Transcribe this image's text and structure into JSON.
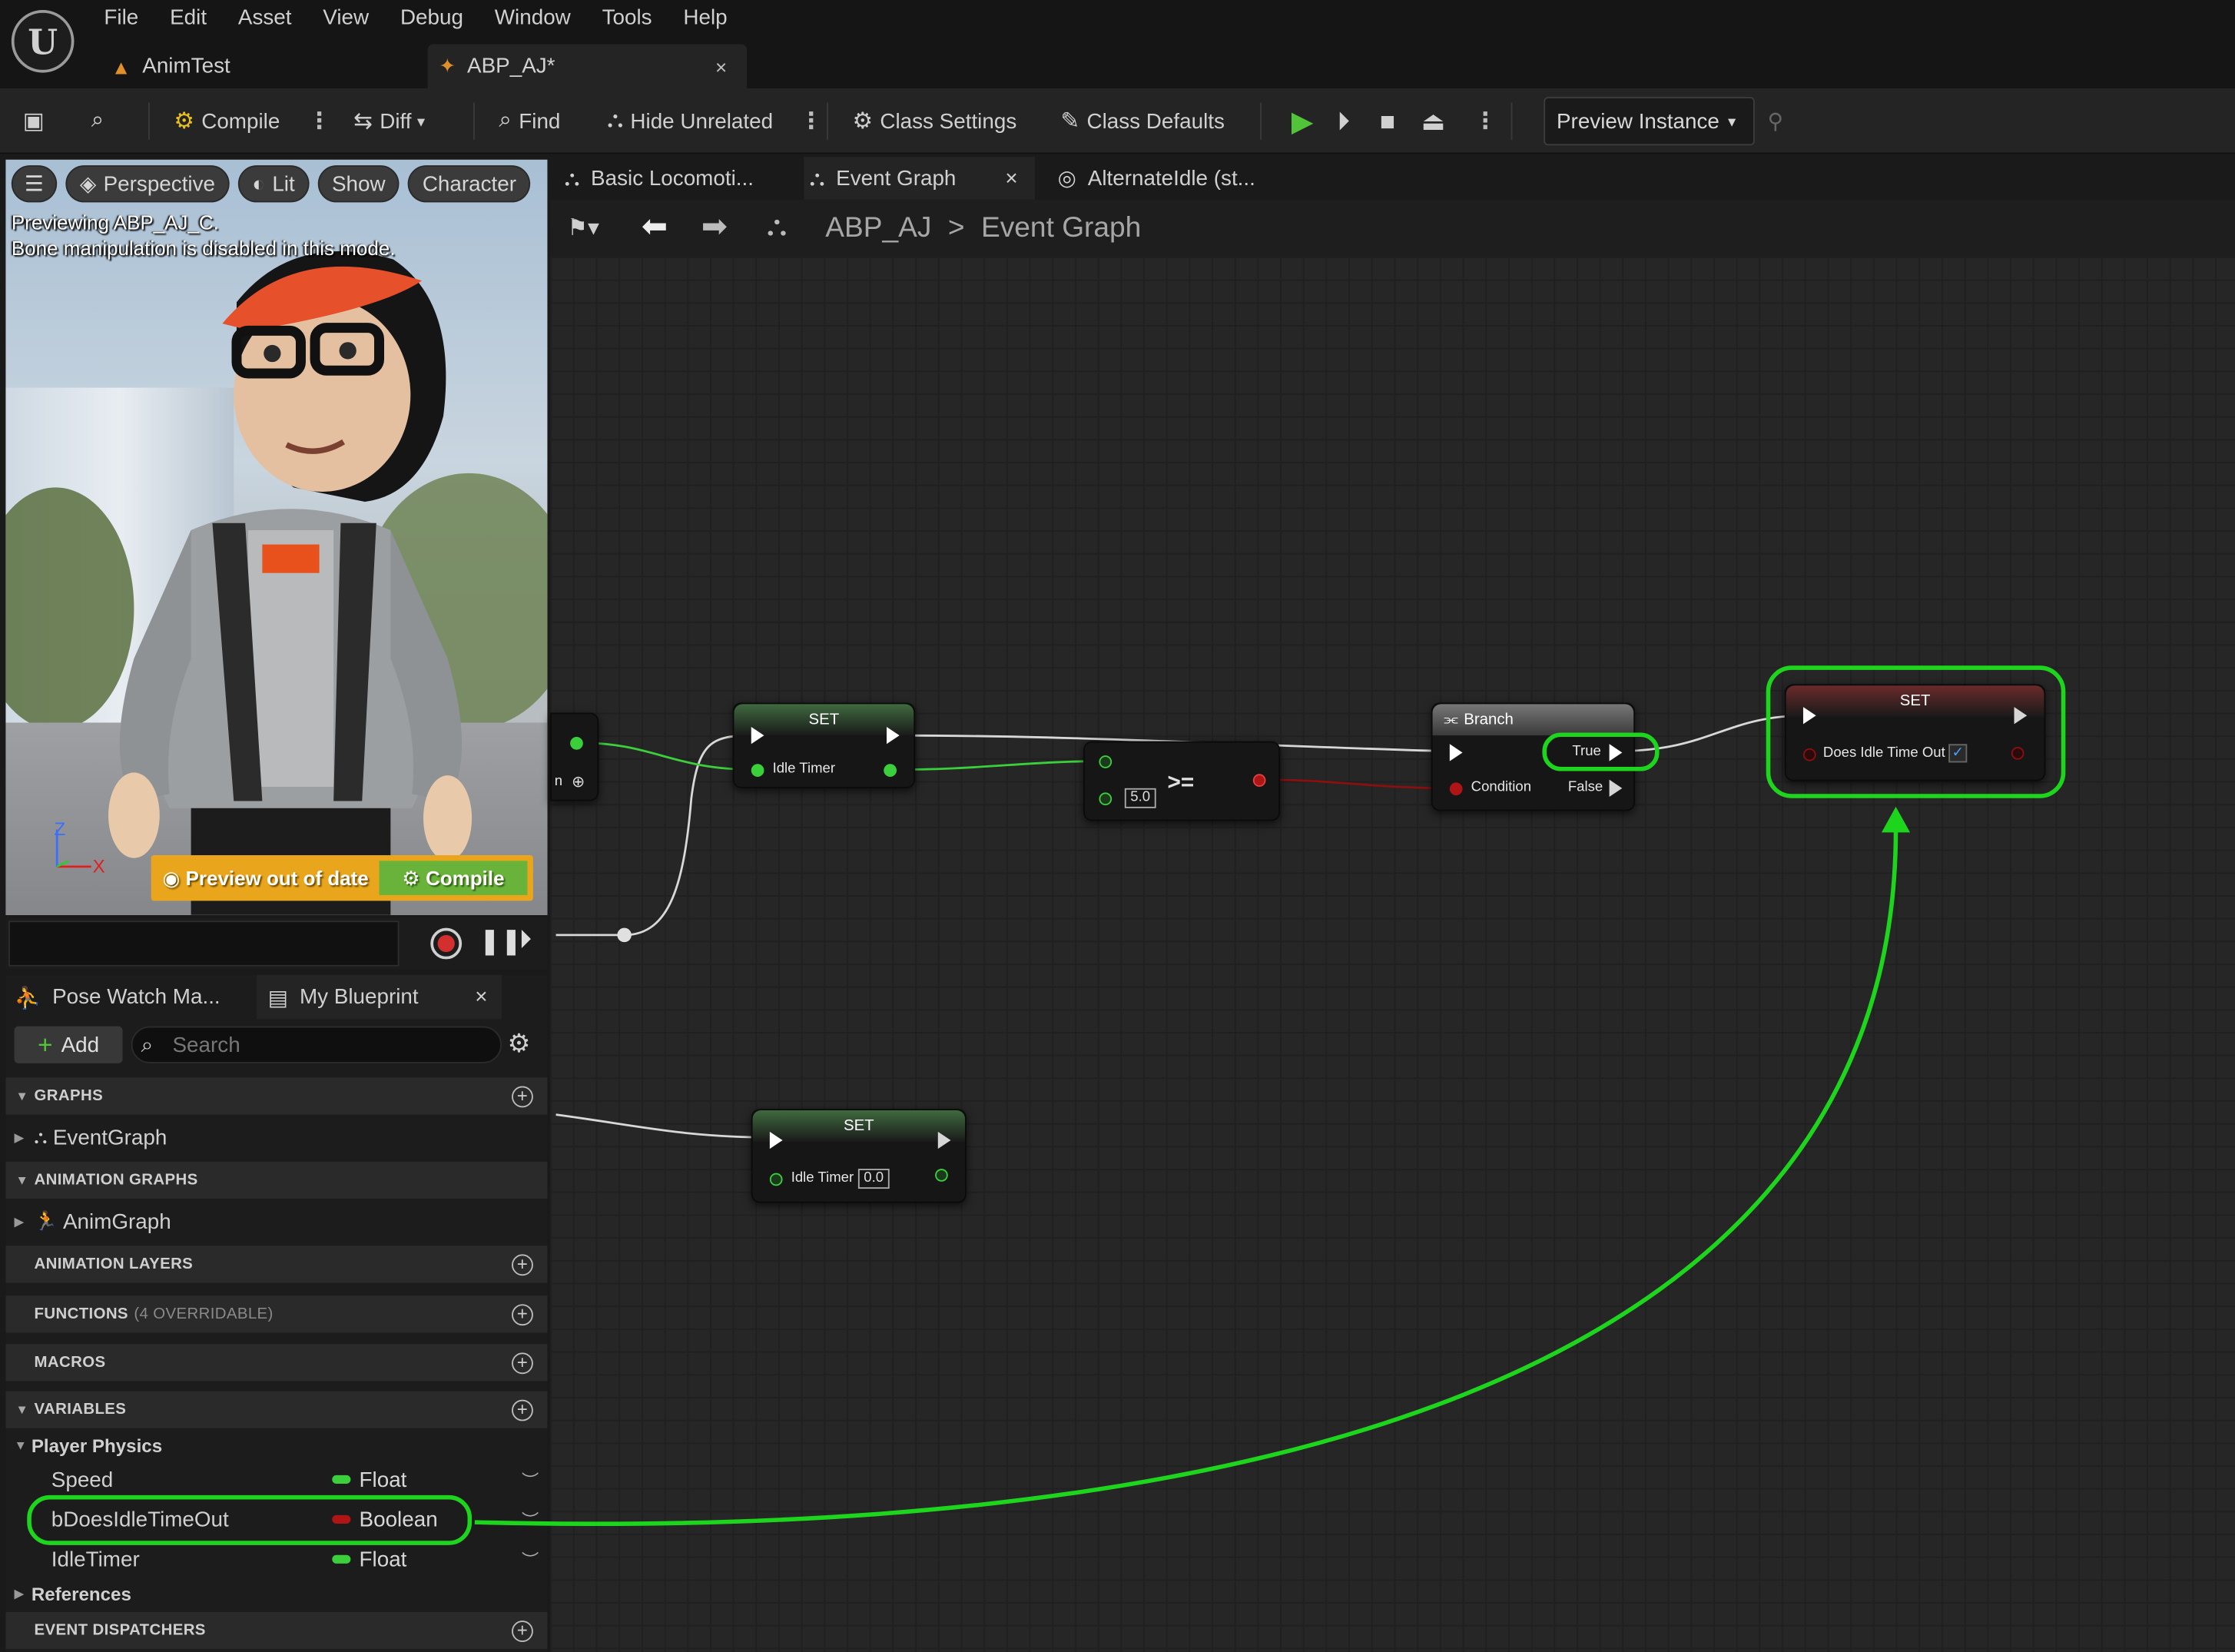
{
  "app": {
    "logo": "U"
  },
  "menu": [
    "File",
    "Edit",
    "Asset",
    "View",
    "Debug",
    "Window",
    "Tools",
    "Help"
  ],
  "doc_tabs": [
    {
      "label": "AnimTest",
      "active": false
    },
    {
      "label": "ABP_AJ*",
      "active": true,
      "close": "×"
    }
  ],
  "toolbar": {
    "compile": "Compile",
    "diff": "Diff",
    "find": "Find",
    "hide_unrelated": "Hide Unrelated",
    "class_settings": "Class Settings",
    "class_defaults": "Class Defaults",
    "preview_instance": "Preview Instance"
  },
  "viewport": {
    "buttons": [
      "Perspective",
      "Lit",
      "Show",
      "Character"
    ],
    "line1": "Previewing ABP_AJ_C.",
    "line2": "Bone manipulation is disabled in this mode.",
    "axis_z": "Z",
    "axis_x": "X",
    "warn": "Preview out of date",
    "compile": "Compile"
  },
  "left_panel": {
    "tabs": [
      {
        "label": "Pose Watch Ma...",
        "active": false
      },
      {
        "label": "My Blueprint",
        "active": true,
        "close": "×"
      }
    ],
    "add": "Add",
    "search_placeholder": "Search",
    "categories": {
      "graphs": "GRAPHS",
      "event_graph": "EventGraph",
      "animation_graphs": "ANIMATION GRAPHS",
      "anim_graph": "AnimGraph",
      "animation_layers": "ANIMATION LAYERS",
      "functions": "FUNCTIONS",
      "functions_sub": "(4 OVERRIDABLE)",
      "macros": "MACROS",
      "variables": "VARIABLES",
      "player_physics": "Player Physics",
      "references": "References",
      "event_dispatchers": "EVENT DISPATCHERS"
    },
    "variables": [
      {
        "name": "Speed",
        "type": "Float",
        "color": "#3ccf3c"
      },
      {
        "name": "bDoesIdleTimeOut",
        "type": "Boolean",
        "color": "#b01515"
      },
      {
        "name": "IdleTimer",
        "type": "Float",
        "color": "#3ccf3c"
      }
    ]
  },
  "graph": {
    "tabs": [
      {
        "label": "Basic Locomoti...",
        "active": false
      },
      {
        "label": "Event Graph",
        "active": true,
        "close": "×"
      },
      {
        "label": "AlternateIdle (st...",
        "active": false
      }
    ],
    "breadcrumb_root": "ABP_AJ",
    "breadcrumb_sep": ">",
    "breadcrumb_leaf": "Event Graph",
    "nodes": {
      "set1_title": "SET",
      "set1_pin": "Idle Timer",
      "compare_op": ">=",
      "compare_value": "5.0",
      "branch_title": "Branch",
      "branch_true": "True",
      "branch_false": "False",
      "branch_condition": "Condition",
      "set3_title": "SET",
      "set3_pin": "Does Idle Time Out",
      "set3_check": "✓",
      "set2_title": "SET",
      "set2_pin": "Idle Timer",
      "set2_value": "0.0",
      "left_stub_label": "n"
    }
  },
  "colors": {
    "highlight": "#1ed51e",
    "float_pin": "#3ccf3c",
    "bool_pin": "#b01515",
    "play": "#52c43a",
    "warn_bg": "#e9a51c",
    "compile_bg": "#6ab33a"
  }
}
